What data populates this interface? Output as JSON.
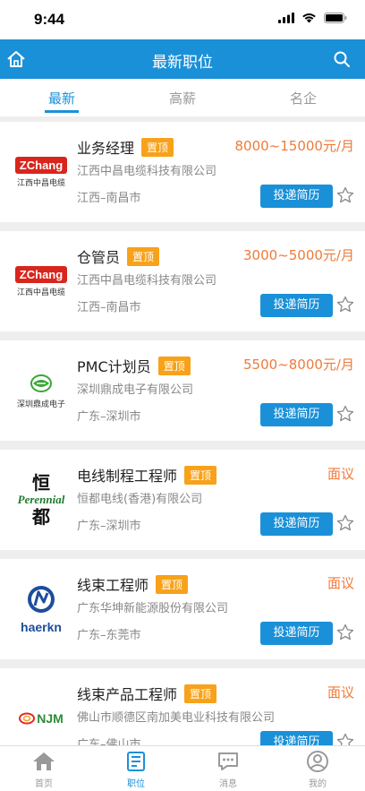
{
  "status": {
    "time": "9:44"
  },
  "nav": {
    "title": "最新职位"
  },
  "tabs": [
    {
      "label": "最新",
      "active": true
    },
    {
      "label": "高薪",
      "active": false
    },
    {
      "label": "名企",
      "active": false
    }
  ],
  "jobs": [
    {
      "title": "业务经理",
      "badge": "置顶",
      "salary": "8000~15000元/月",
      "company": "江西中昌电缆科技有限公司",
      "location": "江西–南昌市",
      "apply_label": "投递简历",
      "logo": {
        "type": "zchang",
        "brand": "ZChang",
        "name": "江西中昌电缆"
      }
    },
    {
      "title": "仓管员",
      "badge": "置顶",
      "salary": "3000~5000元/月",
      "company": "江西中昌电缆科技有限公司",
      "location": "江西–南昌市",
      "apply_label": "投递简历",
      "logo": {
        "type": "zchang",
        "brand": "ZChang",
        "name": "江西中昌电缆"
      }
    },
    {
      "title": "PMC计划员",
      "badge": "置顶",
      "salary": "5500~8000元/月",
      "company": "深圳鼎成电子有限公司",
      "location": "广东–深圳市",
      "apply_label": "投递简历",
      "logo": {
        "type": "dingcheng",
        "brand": "",
        "name": "深圳鼎成电子"
      }
    },
    {
      "title": "电线制程工程师",
      "badge": "置顶",
      "salary": "面议",
      "company": "恒都电线(香港)有限公司",
      "location": "广东–深圳市",
      "apply_label": "投递简历",
      "logo": {
        "type": "perennial",
        "brand": "Perennial",
        "name": "恒 都"
      }
    },
    {
      "title": "线束工程师",
      "badge": "置顶",
      "salary": "面议",
      "company": "广东华坤新能源股份有限公司",
      "location": "广东–东莞市",
      "apply_label": "投递简历",
      "logo": {
        "type": "haerkn",
        "brand": "haerkn",
        "name": ""
      }
    },
    {
      "title": "线束产品工程师",
      "badge": "置顶",
      "salary": "面议",
      "company": "佛山市顺德区南加美电业科技有限公司",
      "location": "广东–佛山市",
      "apply_label": "投递简历",
      "logo": {
        "type": "njm",
        "brand": "NJM",
        "name": ""
      }
    }
  ],
  "tab_bar": [
    {
      "label": "首页",
      "icon": "home-icon",
      "active": false
    },
    {
      "label": "职位",
      "icon": "document-icon",
      "active": true
    },
    {
      "label": "消息",
      "icon": "chat-icon",
      "active": false
    },
    {
      "label": "我的",
      "icon": "user-icon",
      "active": false
    }
  ],
  "colors": {
    "primary": "#1a90d8",
    "badge": "#f7a21a",
    "salary": "#f07a3a"
  }
}
